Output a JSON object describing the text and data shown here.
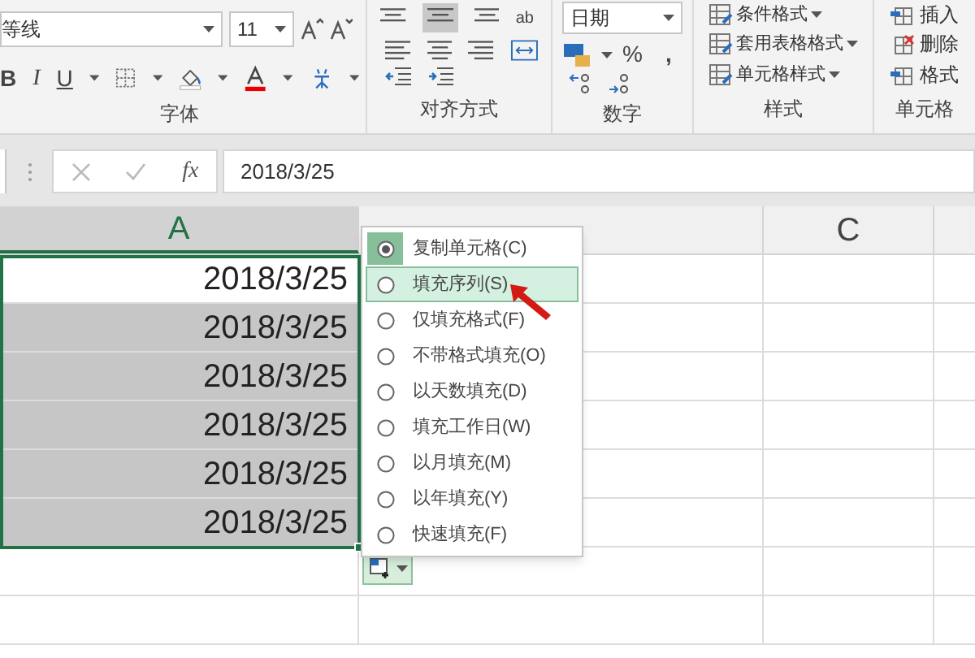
{
  "ribbon": {
    "font": {
      "name": "等线",
      "size": "11",
      "bold": "B",
      "italic": "I",
      "underline": "U",
      "label": "字体"
    },
    "alignment": {
      "label": "对齐方式",
      "wrap_icon": "ab"
    },
    "number": {
      "format": "日期",
      "percent": "%",
      "comma": ",",
      "label": "数字"
    },
    "styles": {
      "buttons": [
        "条件格式",
        "套用表格格式",
        "单元格样式"
      ],
      "label": "样式"
    },
    "cells": {
      "buttons": [
        "插入",
        "删除",
        "格式"
      ],
      "label": "单元格"
    }
  },
  "formula_bar": {
    "fx": "fx",
    "value": "2018/3/25"
  },
  "columns": [
    {
      "name": "A",
      "selected": true
    },
    {
      "selected": false
    },
    {
      "name": "C",
      "selected": false
    }
  ],
  "rows": [
    {
      "value": "2018/3/25",
      "active": true
    },
    {
      "value": "2018/3/25",
      "active": false
    },
    {
      "value": "2018/3/25",
      "active": false
    },
    {
      "value": "2018/3/25",
      "active": false
    },
    {
      "value": "2018/3/25",
      "active": false
    },
    {
      "value": "2018/3/25",
      "active": false
    }
  ],
  "fill_menu": [
    {
      "label": "复制单元格(C)",
      "selected": true,
      "highlighted": false
    },
    {
      "label": "填充序列(S)",
      "selected": false,
      "highlighted": true
    },
    {
      "label": "仅填充格式(F)",
      "selected": false,
      "highlighted": false
    },
    {
      "label": "不带格式填充(O)",
      "selected": false,
      "highlighted": false
    },
    {
      "label": "以天数填充(D)",
      "selected": false,
      "highlighted": false
    },
    {
      "label": "填充工作日(W)",
      "selected": false,
      "highlighted": false
    },
    {
      "label": "以月填充(M)",
      "selected": false,
      "highlighted": false
    },
    {
      "label": "以年填充(Y)",
      "selected": false,
      "highlighted": false
    },
    {
      "label": "快速填充(F)",
      "selected": false,
      "highlighted": false
    }
  ]
}
